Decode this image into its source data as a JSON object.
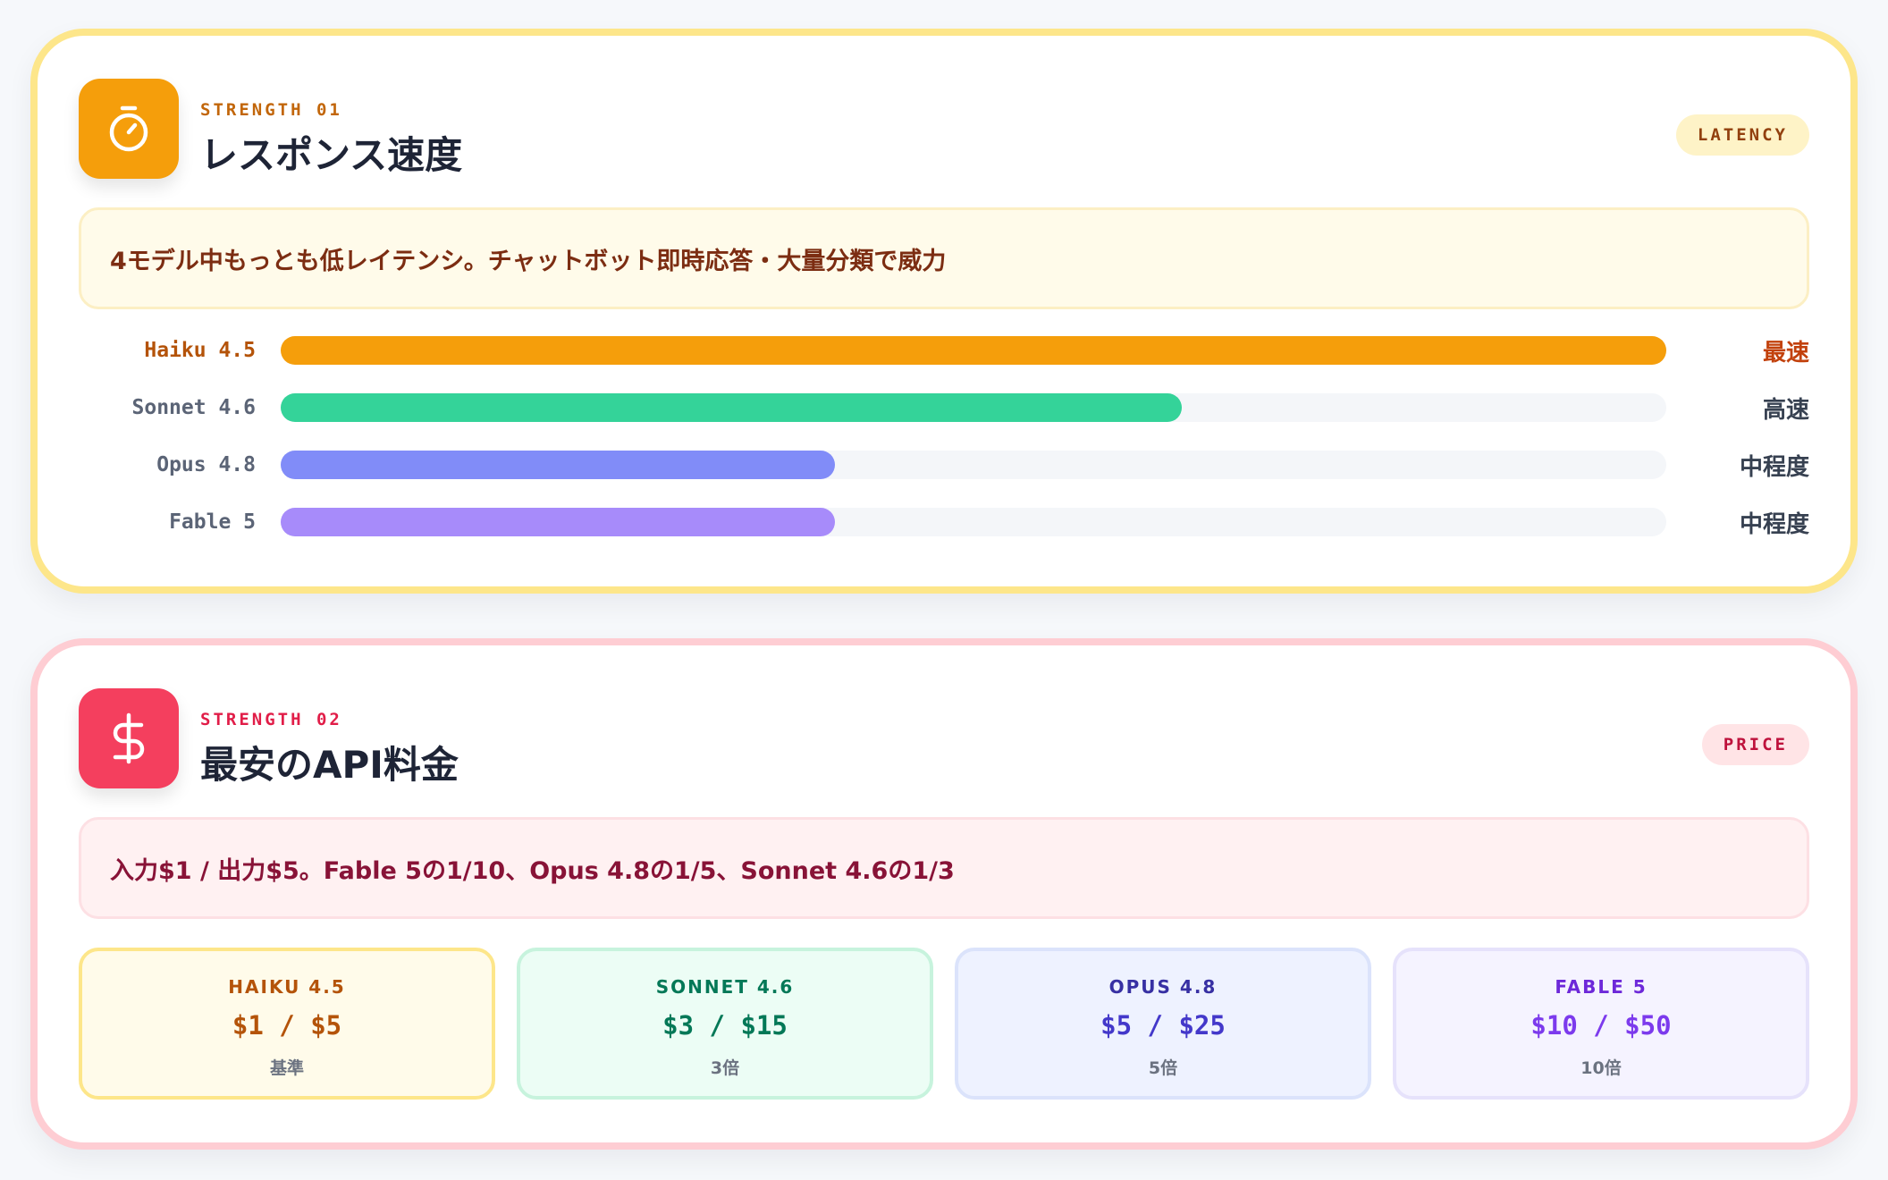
{
  "latency_card": {
    "eyebrow": "STRENGTH 01",
    "title": "レスポンス速度",
    "tag": "LATENCY",
    "icon": "stopwatch-icon",
    "callout": "4モデル中もっとも低レイテンシ。チャットボット即時応答・大量分類で威力",
    "bars": [
      {
        "label": "Haiku 4.5",
        "value": "最速",
        "fill": 1.0,
        "color": "#f59e0b"
      },
      {
        "label": "Sonnet 4.6",
        "value": "高速",
        "fill": 0.65,
        "color": "#34d399"
      },
      {
        "label": "Opus 4.8",
        "value": "中程度",
        "fill": 0.4,
        "color": "#818cf8"
      },
      {
        "label": "Fable 5",
        "value": "中程度",
        "fill": 0.4,
        "color": "#a78bfa"
      }
    ]
  },
  "price_card": {
    "eyebrow": "STRENGTH 02",
    "title": "最安のAPI料金",
    "tag": "PRICE",
    "icon": "dollar-icon",
    "callout": "入力$1 / 出力$5。Fable 5の1/10、Opus 4.8の1/5、Sonnet 4.6の1/3",
    "models": [
      {
        "name": "HAIKU 4.5",
        "price": "$1  /  $5",
        "ratio": "基準",
        "bg": "#fffbea",
        "border": "#fde68a",
        "name_color": "#b45309",
        "price_color": "#b45309"
      },
      {
        "name": "SONNET 4.6",
        "price": "$3  /  $15",
        "ratio": "3倍",
        "bg": "#ecfdf5",
        "border": "#c7f3dd",
        "name_color": "#047857",
        "price_color": "#047857"
      },
      {
        "name": "OPUS 4.8",
        "price": "$5  /  $25",
        "ratio": "5倍",
        "bg": "#eef2ff",
        "border": "#dbe3fb",
        "name_color": "#3730a3",
        "price_color": "#4338ca"
      },
      {
        "name": "FABLE 5",
        "price": "$10  /  $50",
        "ratio": "10倍",
        "bg": "#f5f3ff",
        "border": "#e6e2fb",
        "name_color": "#6d28d9",
        "price_color": "#7c3aed"
      }
    ]
  }
}
